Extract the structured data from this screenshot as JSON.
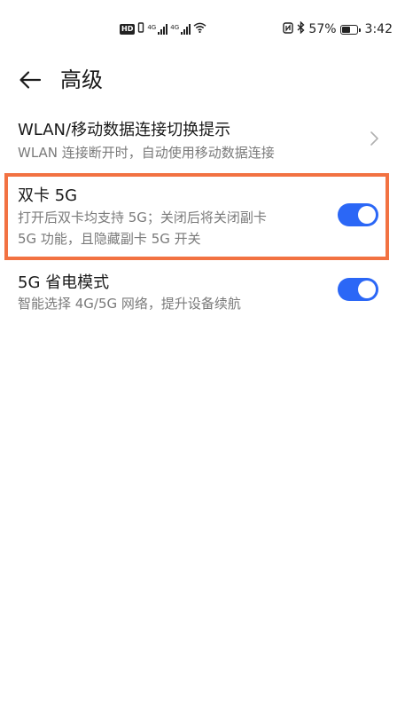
{
  "status_bar": {
    "hd": "HD",
    "sim1_network": "4G",
    "sim2_network": "4G",
    "battery_percent": "57%",
    "battery_level": 0.57,
    "time": "3:42",
    "icons": [
      "hd-icon",
      "vibrate-icon",
      "signal-icon",
      "signal-icon",
      "wifi-icon",
      "nfc-icon",
      "bluetooth-icon",
      "battery-icon"
    ]
  },
  "header": {
    "title": "高级",
    "back_icon": "arrow-left-icon"
  },
  "settings": {
    "wlan_switch": {
      "title": "WLAN/移动数据连接切换提示",
      "subtitle": "WLAN 连接断开时，自动使用移动数据连接",
      "accessory": "chevron-right-icon"
    },
    "dual_sim_5g": {
      "title": "双卡 5G",
      "subtitle_line1": "打开后双卡均支持 5G；关闭后将关闭副卡",
      "subtitle_line2": "5G 功能，且隐藏副卡 5G 开关",
      "enabled": true,
      "highlight_color": "#f27242"
    },
    "power_saving_5g": {
      "title": "5G 省电模式",
      "subtitle": "智能选择 4G/5G 网络，提升设备续航",
      "enabled": true
    }
  },
  "colors": {
    "toggle_on": "#2b67f6",
    "subtitle_text": "#7a7a7a"
  }
}
